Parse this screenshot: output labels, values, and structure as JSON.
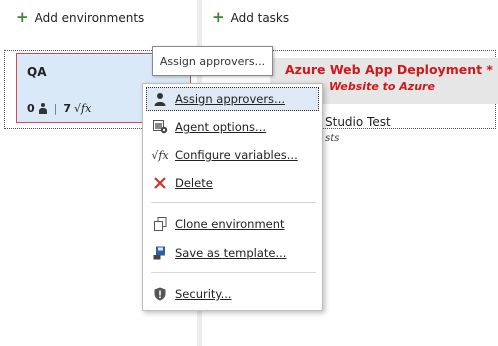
{
  "toolbar": {
    "add_environments": "Add environments",
    "add_tasks": "Add tasks"
  },
  "environment": {
    "name": "QA",
    "approvers_count": "0",
    "variables_count": "7"
  },
  "tasks": [
    {
      "title": "Azure Web App Deployment *",
      "subtitle": "Website to Azure"
    },
    {
      "title": "Studio Test",
      "subtitle": "sts"
    }
  ],
  "tooltip": "Assign approvers...",
  "menu": {
    "items": [
      {
        "label": "Assign approvers...",
        "icon": "person-icon"
      },
      {
        "label": "Agent options...",
        "icon": "agent-gear-icon"
      },
      {
        "label": "Configure variables...",
        "icon": "fx-icon"
      },
      {
        "label": "Delete",
        "icon": "delete-x-icon"
      },
      {
        "label": "Clone environment",
        "icon": "clone-icon"
      },
      {
        "label": "Save as template...",
        "icon": "save-template-icon"
      },
      {
        "label": "Security...",
        "icon": "shield-icon"
      }
    ]
  },
  "colors": {
    "plus_green": "#3a8a2e",
    "card_bg": "#d9e9f7",
    "card_border": "#d04b54",
    "task_title_red": "#cc1a1a",
    "delete_red": "#c8382b",
    "highlight_bg": "#dfe9f5"
  }
}
